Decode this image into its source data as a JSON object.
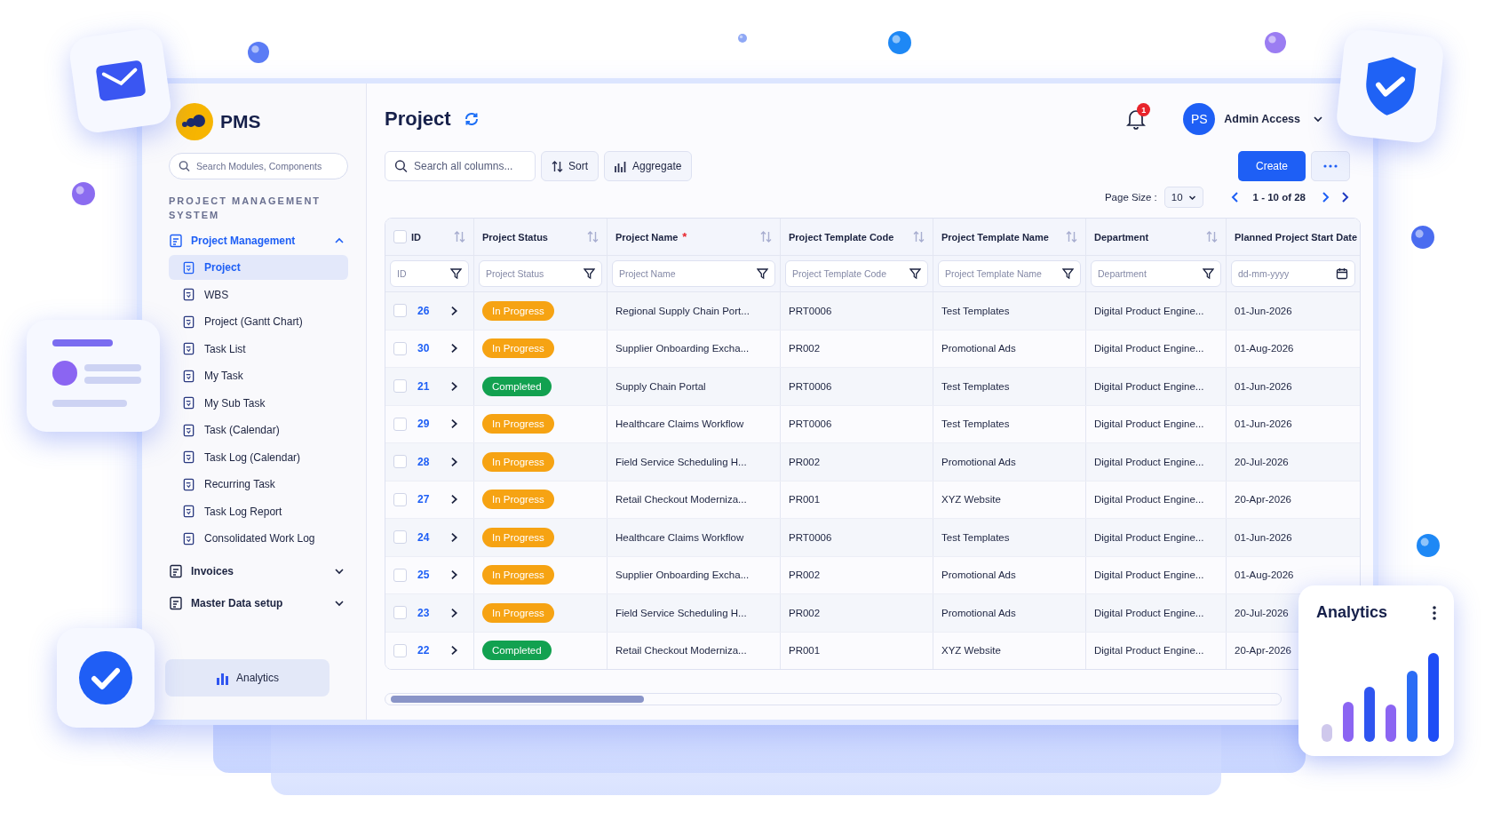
{
  "brand": {
    "name": "PMS"
  },
  "sidebar": {
    "search": {
      "placeholder": "Search Modules, Components"
    },
    "section": "PROJECT MANAGEMENT SYSTEM",
    "groups": [
      {
        "label": "Project Management",
        "expanded": true,
        "selected": true,
        "children": [
          {
            "label": "Project",
            "selected": true
          },
          {
            "label": "WBS",
            "selected": false
          },
          {
            "label": "Project (Gantt Chart)",
            "selected": false
          },
          {
            "label": "Task List",
            "selected": false
          },
          {
            "label": "My Task",
            "selected": false
          },
          {
            "label": "My Sub Task",
            "selected": false
          },
          {
            "label": "Task (Calendar)",
            "selected": false
          },
          {
            "label": "Task Log (Calendar)",
            "selected": false
          },
          {
            "label": "Recurring Task",
            "selected": false
          },
          {
            "label": "Task Log Report",
            "selected": false
          },
          {
            "label": "Consolidated Work Log",
            "selected": false
          }
        ]
      },
      {
        "label": "Invoices",
        "expanded": false,
        "selected": false
      },
      {
        "label": "Master Data setup",
        "expanded": false,
        "selected": false
      }
    ],
    "analytics_button": "Analytics"
  },
  "header": {
    "title": "Project",
    "notification_count": "1",
    "avatar": "PS",
    "user": "Admin Access"
  },
  "toolbar": {
    "search": {
      "placeholder": "Search all columns..."
    },
    "sort": "Sort",
    "aggregate": "Aggregate",
    "create": "Create"
  },
  "pagination": {
    "page_size_label": "Page Size :",
    "page_size": "10",
    "range": "1 - 10 of 28"
  },
  "table": {
    "all_checked": false,
    "columns": [
      {
        "label": "ID",
        "sortable": true,
        "filter": {
          "kind": "filter",
          "placeholder": "ID"
        }
      },
      {
        "label": "Project Status",
        "sortable": true,
        "filter": {
          "kind": "filter",
          "placeholder": "Project Status"
        }
      },
      {
        "label": "Project Name",
        "marker": "*",
        "sortable": true,
        "filter": {
          "kind": "filter",
          "placeholder": "Project Name"
        }
      },
      {
        "label": "Project Template Code",
        "sortable": true,
        "filter": {
          "kind": "filter",
          "placeholder": "Project Template Code"
        }
      },
      {
        "label": "Project Template Name",
        "sortable": true,
        "filter": {
          "kind": "filter",
          "placeholder": "Project Template Name"
        }
      },
      {
        "label": "Department",
        "sortable": true,
        "filter": {
          "kind": "filter",
          "placeholder": "Department"
        }
      },
      {
        "label": "Planned Project Start Date",
        "sortable": false,
        "filter": {
          "kind": "date",
          "placeholder": "dd-mm-yyyy"
        }
      }
    ],
    "rows": [
      {
        "checked": false,
        "id": "26",
        "status": {
          "label": "In Progress",
          "kind": "in_progress"
        },
        "name": "Regional Supply Chain Port...",
        "code": "PRT0006",
        "template": "Test Templates",
        "department": "Digital Product Engine...",
        "start": "01-Jun-2026"
      },
      {
        "checked": false,
        "id": "30",
        "status": {
          "label": "In Progress",
          "kind": "in_progress"
        },
        "name": "Supplier Onboarding Excha...",
        "code": "PR002",
        "template": "Promotional Ads",
        "department": "Digital Product Engine...",
        "start": "01-Aug-2026"
      },
      {
        "checked": false,
        "id": "21",
        "status": {
          "label": "Completed",
          "kind": "completed"
        },
        "name": "Supply Chain Portal",
        "code": "PRT0006",
        "template": "Test Templates",
        "department": "Digital Product Engine...",
        "start": "01-Jun-2026"
      },
      {
        "checked": false,
        "id": "29",
        "status": {
          "label": "In Progress",
          "kind": "in_progress"
        },
        "name": "Healthcare Claims Workflow",
        "code": "PRT0006",
        "template": "Test Templates",
        "department": "Digital Product Engine...",
        "start": "01-Jun-2026"
      },
      {
        "checked": false,
        "id": "28",
        "status": {
          "label": "In Progress",
          "kind": "in_progress"
        },
        "name": "Field Service Scheduling H...",
        "code": "PR002",
        "template": "Promotional Ads",
        "department": "Digital Product Engine...",
        "start": "20-Jul-2026"
      },
      {
        "checked": false,
        "id": "27",
        "status": {
          "label": "In Progress",
          "kind": "in_progress"
        },
        "name": "Retail Checkout Moderniza...",
        "code": "PR001",
        "template": "XYZ Website",
        "department": "Digital Product Engine...",
        "start": "20-Apr-2026"
      },
      {
        "checked": false,
        "id": "24",
        "status": {
          "label": "In Progress",
          "kind": "in_progress"
        },
        "name": "Healthcare Claims Workflow",
        "code": "PRT0006",
        "template": "Test Templates",
        "department": "Digital Product Engine...",
        "start": "01-Jun-2026"
      },
      {
        "checked": false,
        "id": "25",
        "status": {
          "label": "In Progress",
          "kind": "in_progress"
        },
        "name": "Supplier Onboarding Excha...",
        "code": "PR002",
        "template": "Promotional Ads",
        "department": "Digital Product Engine...",
        "start": "01-Aug-2026"
      },
      {
        "checked": false,
        "id": "23",
        "status": {
          "label": "In Progress",
          "kind": "in_progress"
        },
        "name": "Field Service Scheduling H...",
        "code": "PR002",
        "template": "Promotional Ads",
        "department": "Digital Product Engine...",
        "start": "20-Jul-2026"
      },
      {
        "checked": false,
        "id": "22",
        "status": {
          "label": "Completed",
          "kind": "completed"
        },
        "name": "Retail Checkout Moderniza...",
        "code": "PR001",
        "template": "XYZ Website",
        "department": "Digital Product Engine...",
        "start": "20-Apr-2026"
      }
    ]
  },
  "analytics_card": {
    "title": "Analytics"
  }
}
